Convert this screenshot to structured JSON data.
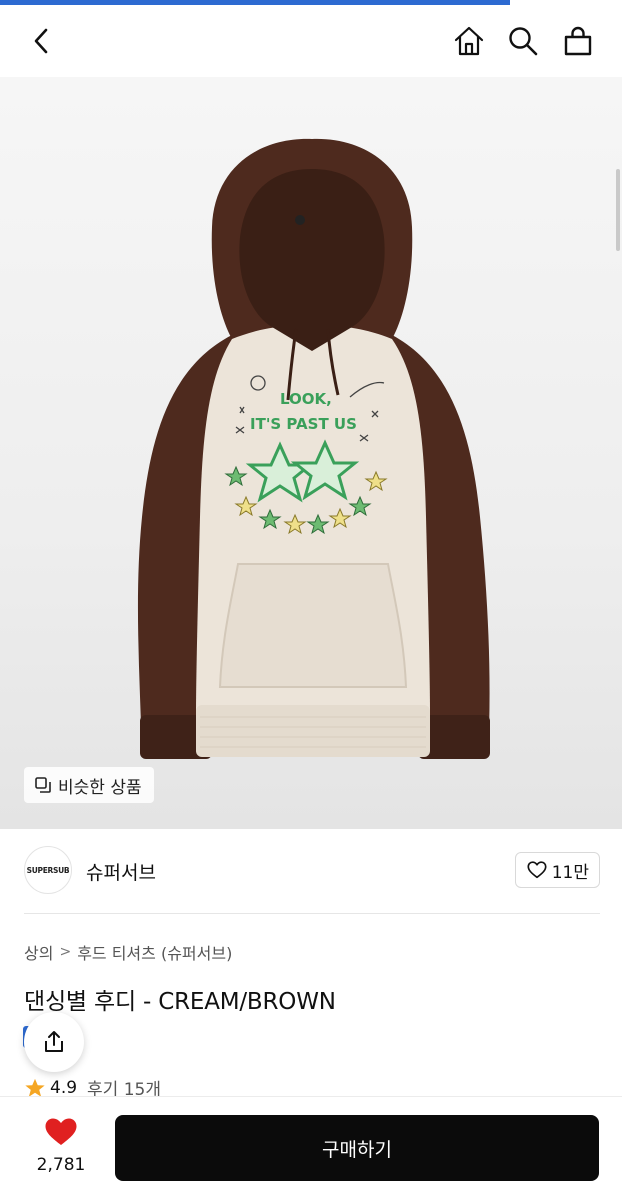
{
  "header": {
    "back_icon": "chevron-left-icon",
    "home_icon": "home-icon",
    "search_icon": "search-icon",
    "bag_icon": "shopping-bag-icon"
  },
  "progress": {
    "fraction": 0.82,
    "color": "#2d6ad1"
  },
  "hero": {
    "similar_label": "비슷한 상품",
    "print_text_line1": "LOOK,",
    "print_text_line2": "IT'S PAST US"
  },
  "brand": {
    "logo_text": "SUPERSUB",
    "name": "슈퍼서브",
    "like_count": "11만"
  },
  "breadcrumb": {
    "items": [
      "상의",
      "후드 티셔츠 (슈퍼서브)"
    ],
    "separator": ">"
  },
  "product": {
    "title": "댄싱별 후디 - CREAM/BROWN"
  },
  "rating": {
    "score": "4.9",
    "reviews": "후기 15개"
  },
  "bottom_bar": {
    "wish_count": "2,781",
    "buy_label": "구매하기"
  },
  "colors": {
    "accent_blue": "#2d6ad1",
    "heart_red": "#e02020",
    "star_orange": "#f5a623",
    "buy_button_bg": "#0b0b0b"
  }
}
